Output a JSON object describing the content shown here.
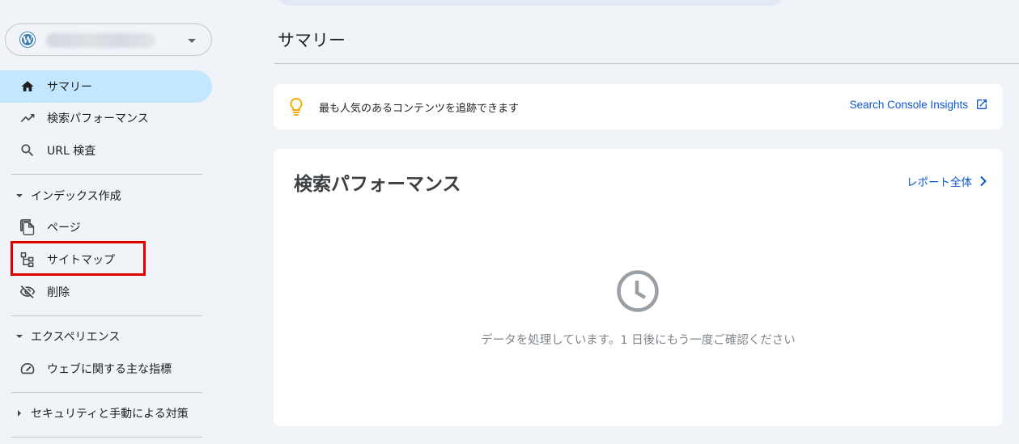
{
  "sidebar": {
    "property_icon": "wordpress-logo",
    "property_name": "",
    "items": [
      {
        "label": "サマリー",
        "icon": "home-icon"
      },
      {
        "label": "検索パフォーマンス",
        "icon": "trending-up-icon"
      },
      {
        "label": "URL 検査",
        "icon": "search-icon"
      }
    ],
    "sections": [
      {
        "label": "インデックス作成",
        "expanded": true,
        "items": [
          {
            "label": "ページ",
            "icon": "pages-icon"
          },
          {
            "label": "サイトマップ",
            "icon": "sitemap-icon"
          },
          {
            "label": "削除",
            "icon": "eye-off-icon"
          }
        ]
      },
      {
        "label": "エクスペリエンス",
        "expanded": true,
        "items": [
          {
            "label": "ウェブに関する主な指標",
            "icon": "speed-icon"
          }
        ]
      },
      {
        "label": "セキュリティと手動による対策",
        "expanded": false,
        "items": []
      }
    ]
  },
  "main": {
    "title": "サマリー",
    "insight": {
      "text": "最も人気のあるコンテンツを追跡できます",
      "link": "Search Console Insights"
    },
    "performance": {
      "title": "検索パフォーマンス",
      "link": "レポート全体",
      "message": "データを処理しています。1 日後にもう一度ご確認ください"
    }
  },
  "colors": {
    "accent": "#0b57d0",
    "active_nav": "#c2e7ff",
    "highlight_box": "#e00000",
    "bulb": "#f9ab00",
    "background": "#f0f4f9"
  }
}
